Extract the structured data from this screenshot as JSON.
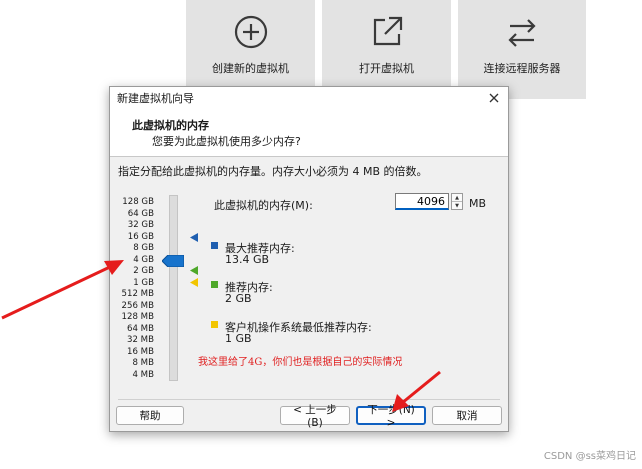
{
  "home_tiles": [
    {
      "label": "创建新的虚拟机",
      "icon": "plus-circle-icon"
    },
    {
      "label": "打开虚拟机",
      "icon": "open-external-icon"
    },
    {
      "label": "连接远程服务器",
      "icon": "swap-arrows-icon"
    }
  ],
  "dialog": {
    "title": "新建虚拟机向导",
    "header_title": "此虚拟机的内存",
    "header_subtitle": "您要为此虚拟机使用多少内存?",
    "description": "指定分配给此虚拟机的内存量。内存大小必须为 4 MB 的倍数。",
    "memory_label": "此虚拟机的内存(M):",
    "memory_value": "4096",
    "memory_unit": "MB",
    "scale": [
      "128 GB",
      "64 GB",
      "32 GB",
      "16 GB",
      "8 GB",
      "4 GB",
      "2 GB",
      "1 GB",
      "512 MB",
      "256 MB",
      "128 MB",
      "64 MB",
      "32 MB",
      "16 MB",
      "8 MB",
      "4 MB"
    ],
    "slider_value_mb": 4096,
    "legend": [
      {
        "title": "最大推荐内存:",
        "value": "13.4 GB",
        "color": "#1f5fb0"
      },
      {
        "title": "推荐内存:",
        "value": "2 GB",
        "color": "#4ea82a"
      },
      {
        "title": "客户机操作系统最低推荐内存:",
        "value": "1 GB",
        "color": "#f2c500"
      }
    ],
    "buttons": {
      "help": "帮助",
      "back": "< 上一步(B)",
      "next": "下一步(N) >",
      "cancel": "取消"
    }
  },
  "annotation_note": "我这里给了4G，你们也是根据自己的实际情况",
  "watermark": "CSDN @ss菜鸡日记",
  "colors": {
    "accent": "#0060c0",
    "annotation": "#e02020"
  }
}
